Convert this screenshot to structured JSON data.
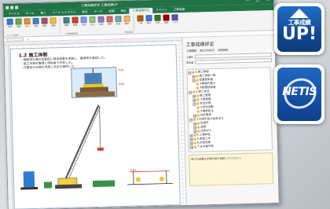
{
  "window": {
    "title": "工事成績評定 工事成績UP",
    "controls": [
      "—",
      "□",
      "✕"
    ]
  },
  "ribbon_tabs": [
    "ファイル",
    "ホーム",
    "挿入",
    "ページ レイアウト",
    "数式",
    "データ",
    "校閲",
    "表示",
    "工事成績評定",
    "アドイン",
    "工事成績"
  ],
  "active_tab_index": 8,
  "ribbon": {
    "buttons": [
      {
        "label": "評定",
        "color": "#2f7bd3"
      },
      {
        "label": "項目",
        "color": "#6aa84f"
      },
      {
        "label": "記入",
        "color": "#e69138"
      },
      {
        "label": "写真",
        "color": "#3d85c6"
      },
      {
        "label": "資料",
        "color": "#a64d79"
      },
      {
        "label": "書類",
        "color": "#f1c232"
      },
      {
        "label": "検索",
        "color": "#45818e"
      },
      {
        "label": "整理",
        "color": "#cc4125"
      },
      {
        "label": "比較",
        "color": "#6d9eeb"
      },
      {
        "label": "出力",
        "color": "#93c47d"
      },
      {
        "label": "印刷",
        "color": "#8e7cc3"
      },
      {
        "label": "保存",
        "color": "#e06666"
      },
      {
        "label": "設定",
        "color": "#76a5af"
      },
      {
        "label": "集計",
        "color": "#f6b26b"
      },
      {
        "label": "一覧",
        "color": "#b45f06"
      },
      {
        "label": "表示",
        "color": "#3c78d8"
      },
      {
        "label": "分析",
        "color": "#38761d"
      },
      {
        "label": "管理",
        "color": "#990000"
      },
      {
        "label": "ヘルプ",
        "color": "#674ea7"
      }
    ],
    "groups": [
      "ファイル操作",
      "工事成績評定",
      "表示設定"
    ]
  },
  "formula": {
    "namebox": "",
    "fx": "fx"
  },
  "sheet": {
    "section_title": "1.2 施工体制",
    "bullets": [
      "・鋼製排水溝の設置前に現地測量を実施し、基準高を確認した。",
      "・施工手順を整理し関係者で共有した。",
      "・作業前の点検を実施し安全を確保した。"
    ],
    "callouts": [
      "写真1",
      "写真2",
      "写真3"
    ]
  },
  "panel": {
    "title": "工事成績評定",
    "toolbar": [
      "工事情報",
      "施工プロセス",
      "評定結果"
    ],
    "fields": [
      {
        "label": "工事名"
      },
      {
        "label": "発注者"
      }
    ],
    "tree": [
      {
        "label": "1.施工体制",
        "level": 0,
        "exp": "−"
      },
      {
        "label": "施工体制一般",
        "level": 1,
        "exp": "+"
      },
      {
        "label": "配置技術者",
        "level": 1,
        "exp": "−"
      },
      {
        "label": "①現場代理人",
        "level": 2,
        "exp": ""
      },
      {
        "label": "②監理技術者",
        "level": 2,
        "exp": ""
      },
      {
        "label": "2.施工状況",
        "level": 0,
        "exp": "−"
      },
      {
        "label": "施工管理",
        "level": 1,
        "exp": "+"
      },
      {
        "label": "工程管理",
        "level": 1,
        "exp": "+"
      },
      {
        "label": "安全対策",
        "level": 1,
        "exp": "−"
      },
      {
        "label": "①安全活動",
        "level": 2,
        "exp": ""
      },
      {
        "label": "②事故防止",
        "level": 2,
        "exp": ""
      },
      {
        "label": "対外関係",
        "level": 1,
        "exp": "+"
      },
      {
        "label": "3.出来形及び出来ばえ",
        "level": 0,
        "exp": "−"
      },
      {
        "label": "出来形",
        "level": 1,
        "exp": "+"
      },
      {
        "label": "品質",
        "level": 1,
        "exp": "+"
      },
      {
        "label": "出来ばえ",
        "level": 1,
        "exp": "+"
      },
      {
        "label": "4.工事特性",
        "level": 0,
        "exp": "+"
      },
      {
        "label": "5.創意工夫",
        "level": 0,
        "exp": "+"
      },
      {
        "label": "6.社会性等",
        "level": 0,
        "exp": "+"
      },
      {
        "label": "7.法令遵守等",
        "level": 0,
        "exp": "+"
      }
    ],
    "note": "施工計画書の記載内容を確認してください。"
  },
  "badge_up": {
    "line1": "工事成績",
    "line2": "UP!"
  },
  "badge_netis": {
    "text": "NETIS"
  }
}
